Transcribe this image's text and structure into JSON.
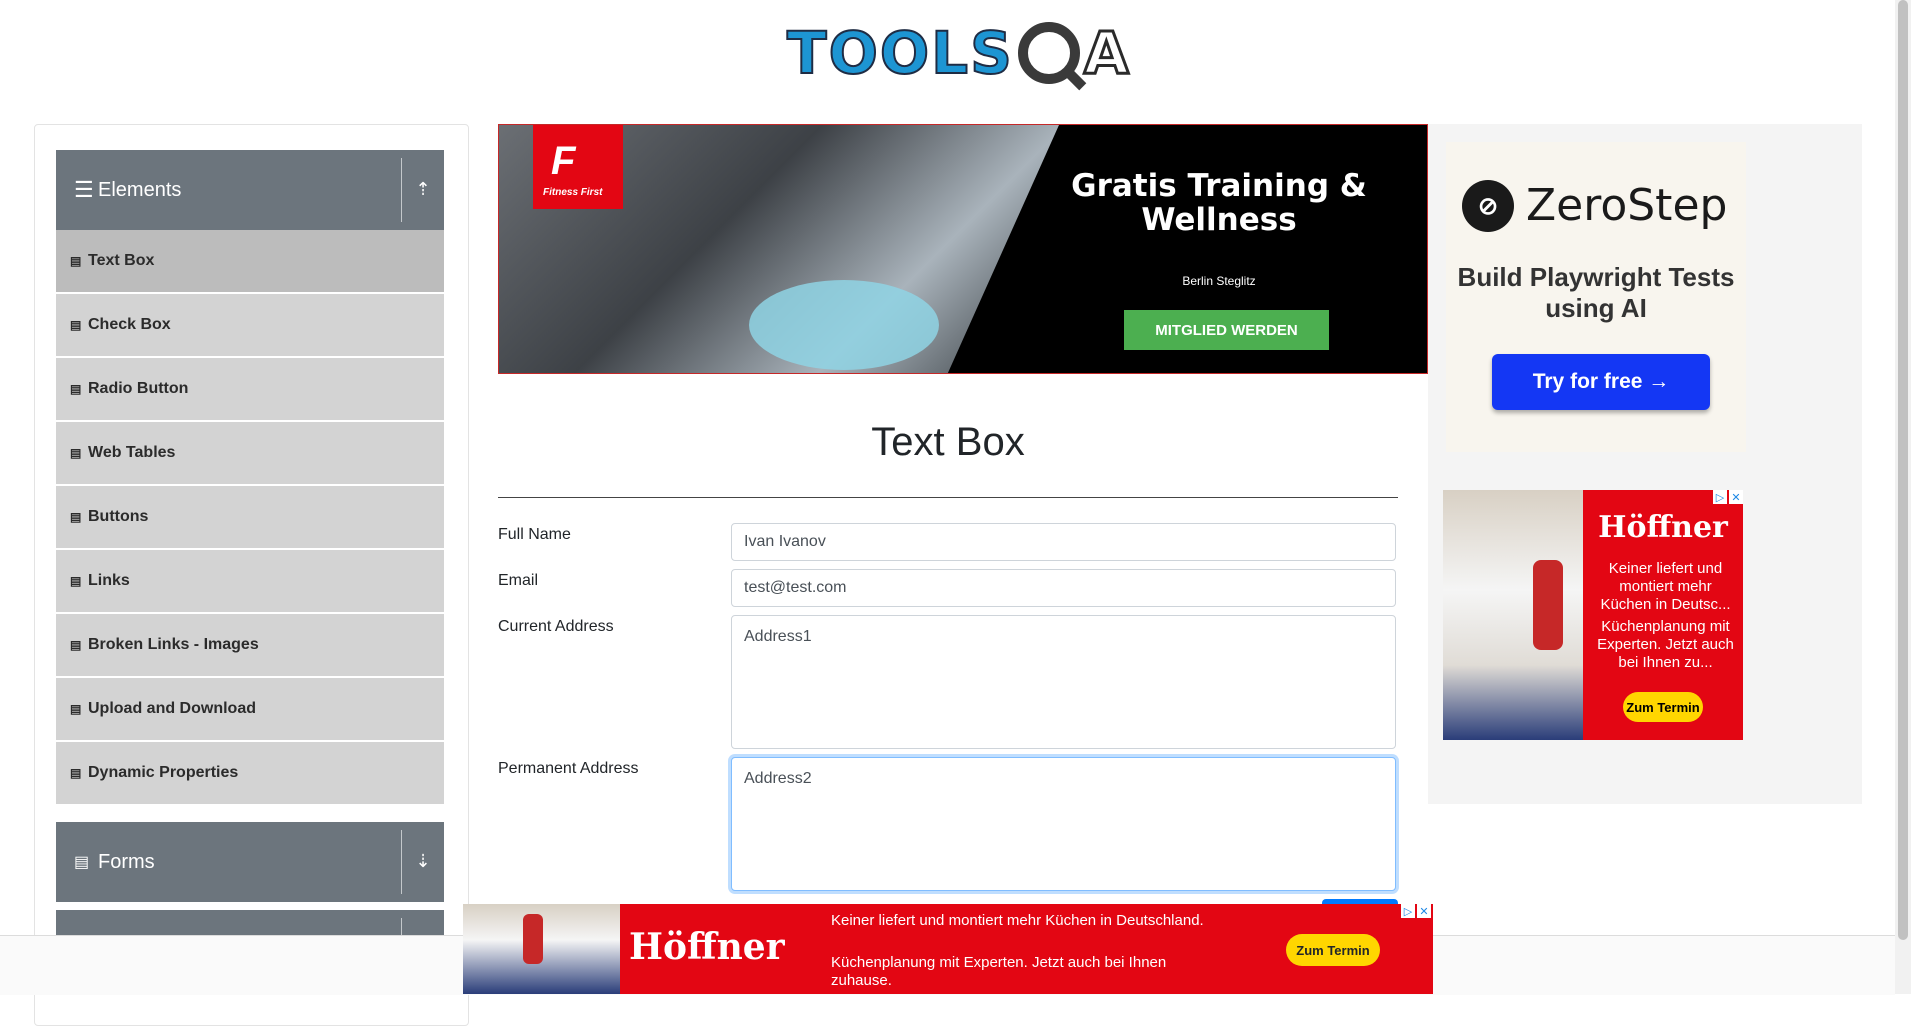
{
  "header": {
    "logo_text": "TOOLS",
    "logo_a": "A"
  },
  "sidebar": {
    "groups": [
      {
        "label": "Elements",
        "icon": "hamburger-icon",
        "toggle": "collapse-up-icon"
      },
      {
        "label": "Forms",
        "icon": "doc-icon",
        "toggle": "expand-down-icon"
      }
    ],
    "items": [
      {
        "label": "Text Box"
      },
      {
        "label": "Check Box"
      },
      {
        "label": "Radio Button"
      },
      {
        "label": "Web Tables"
      },
      {
        "label": "Buttons"
      },
      {
        "label": "Links"
      },
      {
        "label": "Broken Links - Images"
      },
      {
        "label": "Upload and Download"
      },
      {
        "label": "Dynamic Properties"
      }
    ]
  },
  "ad_top": {
    "brand_big": "F",
    "brand_small": "Fitness First",
    "headline": "Gratis Training & Wellness",
    "location": "Berlin Steglitz",
    "cta": "MITGLIED WERDEN"
  },
  "main": {
    "title": "Text Box",
    "fields": {
      "full_name_label": "Full Name",
      "full_name_value": "Ivan Ivanov",
      "email_label": "Email",
      "email_value": "test@test.com",
      "current_address_label": "Current Address",
      "current_address_value": "Address1",
      "permanent_address_label": "Permanent Address",
      "permanent_address_value": "Address2"
    }
  },
  "ad_right": {
    "zerostep": {
      "brand": "ZeroStep",
      "tagline": "Build Playwright Tests using AI",
      "cta": "Try for free →"
    },
    "hoeffner": {
      "brand": "Höffner",
      "text1": "Keiner liefert und montiert mehr Küchen in Deutsc...",
      "text2": "Küchenplanung mit Experten. Jetzt auch bei Ihnen zu...",
      "cta": "Zum Termin"
    }
  },
  "ad_bottom": {
    "brand": "Höffner",
    "text1": "Keiner liefert und montiert mehr Küchen in Deutschland.",
    "text2": "Küchenplanung mit Experten. Jetzt auch bei Ihnen zuhause.",
    "cta": "Zum Termin"
  },
  "colors": {
    "sidebar_header": "#6c757d",
    "sidebar_item": "#d3d3d3",
    "ad_red": "#e30613",
    "primary": "#007bff"
  }
}
